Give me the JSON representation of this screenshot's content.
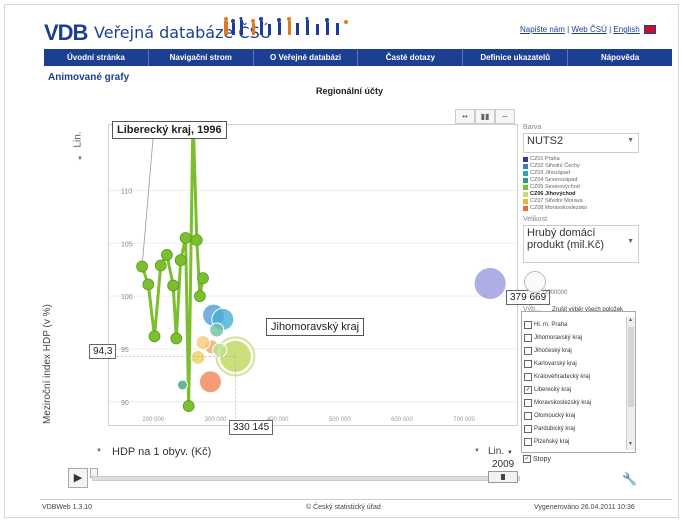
{
  "header": {
    "logo": "VDB",
    "title": "Veřejná databáze ČSÚ",
    "top_links": {
      "write_us": "Napište nám",
      "web_csu": "Web ČSÚ",
      "english": "English"
    }
  },
  "nav": {
    "items": [
      "Úvodní stránka",
      "Navigační strom",
      "O Veřejné databázi",
      "Časté dotazy",
      "Definice ukazatelů",
      "Nápověda"
    ]
  },
  "page": {
    "section_title": "Animované grafy",
    "chart_title": "Regionální účty"
  },
  "chart": {
    "y_axis_title": "Meziroční index HDP (v %)",
    "y_scale": "Lin.",
    "x_axis_title": "HDP na 1 obyv. (Kč)",
    "x_scale": "Lin.",
    "tooltips": {
      "liberec_trail": "Liberecký kraj, 1996",
      "jihomoravsky": "Jihomoravský kraj",
      "x_value": "330 145",
      "y_value": "94,3",
      "size_value": "379 669"
    }
  },
  "chart_data": {
    "type": "scatter",
    "title": "Regionální účty",
    "xlabel": "HDP na 1 obyv. (Kč)",
    "ylabel": "Meziroční index HDP (v %)",
    "x_ticks": [
      "200 000",
      "300 000",
      "400 000",
      "500 000",
      "600 000",
      "700 000"
    ],
    "y_ticks": [
      "90",
      "95",
      "100",
      "105",
      "110"
    ],
    "xlim": [
      130000,
      780000
    ],
    "ylim": [
      88,
      116
    ],
    "series": [
      {
        "name": "Liberecký kraj",
        "color": "#7bbf2e",
        "trail": true,
        "points": [
          [
            180000,
            102.8
          ],
          [
            190000,
            101.1
          ],
          [
            200000,
            96.2
          ],
          [
            210000,
            102.9
          ],
          [
            220000,
            103.9
          ],
          [
            230000,
            101.0
          ],
          [
            235000,
            96.0
          ],
          [
            242000,
            103.4
          ],
          [
            250000,
            105.5
          ],
          [
            255000,
            89.6
          ],
          [
            262000,
            117.3
          ],
          [
            268000,
            105.3
          ],
          [
            273000,
            100.0
          ],
          [
            278000,
            101.7
          ]
        ]
      }
    ],
    "bubbles": [
      {
        "name": "Jihomoravský kraj",
        "x": 330145,
        "y": 94.3,
        "color": "#c7dc72",
        "size": "large",
        "highlighted": true
      },
      {
        "name": "",
        "x": 295000,
        "y": 98.2,
        "color": "#4f9ed8",
        "size": "medium"
      },
      {
        "name": "",
        "x": 310000,
        "y": 97.8,
        "color": "#47b0d4",
        "size": "medium"
      },
      {
        "name": "",
        "x": 300000,
        "y": 96.8,
        "color": "#6cc2a0",
        "size": "small"
      },
      {
        "name": "",
        "x": 292000,
        "y": 95.2,
        "color": "#f0a96b",
        "size": "small"
      },
      {
        "name": "",
        "x": 278000,
        "y": 95.6,
        "color": "#f5cc7a",
        "size": "small"
      },
      {
        "name": "",
        "x": 305000,
        "y": 94.9,
        "color": "#bde18b",
        "size": "small"
      },
      {
        "name": "",
        "x": 290000,
        "y": 91.9,
        "color": "#ef8454",
        "size": "medium"
      },
      {
        "name": "",
        "x": 270000,
        "y": 94.2,
        "color": "#e8d25c",
        "size": "small"
      },
      {
        "name": "",
        "x": 245000,
        "y": 91.6,
        "color": "#34a87c",
        "size": "tiny"
      },
      {
        "name": "",
        "x": 740000,
        "y": 101.2,
        "color": "#9a9ae0",
        "size": "large"
      }
    ]
  },
  "panel": {
    "color_label": "Barva",
    "color_value": "NUTS2",
    "legend": [
      {
        "label": "CZ01 Praha",
        "color": "#2f3c9e"
      },
      {
        "label": "CZ02 Střední Čechy",
        "color": "#3f7cc2"
      },
      {
        "label": "CZ03 Jihozápad",
        "color": "#2ea6b5"
      },
      {
        "label": "CZ04 Severozápad",
        "color": "#26a06a"
      },
      {
        "label": "CZ05 Severovýchod",
        "color": "#7bbf2e"
      },
      {
        "label": "CZ06 Jihovýchod",
        "color": "#c7dc72"
      },
      {
        "label": "CZ07 Střední Morava",
        "color": "#f5b23b"
      },
      {
        "label": "CZ08 Moravskoslezsko",
        "color": "#ee6a3a"
      }
    ],
    "size_label": "Velikost",
    "size_value": "Hrubý domácí produkt (mil.Kč)",
    "size_scale_value": "2000000",
    "select_label": "Výb...",
    "deselect_all": "Zrušit výběr všech položek",
    "checklist": [
      {
        "label": "Hl. m. Praha",
        "checked": false
      },
      {
        "label": "Jihomoravský kraj",
        "checked": false
      },
      {
        "label": "Jihočeský kraj",
        "checked": false
      },
      {
        "label": "Karlovarský kraj",
        "checked": false
      },
      {
        "label": "Královéhradecký kraj",
        "checked": false
      },
      {
        "label": "Liberecký kraj",
        "checked": true
      },
      {
        "label": "Moravskoslezský kraj",
        "checked": false
      },
      {
        "label": "Olomoucký kraj",
        "checked": false
      },
      {
        "label": "Pardubický kraj",
        "checked": false
      },
      {
        "label": "Plzeňský kraj",
        "checked": false
      }
    ],
    "trails_label": "Stopy",
    "trails_checked": true
  },
  "timeline": {
    "year": "2009"
  },
  "footer": {
    "version": "VDBWeb 1.3.10",
    "copyright": "© Český statistický úřad",
    "generated": "Vygenerováno 26.04.2011 10:36"
  }
}
